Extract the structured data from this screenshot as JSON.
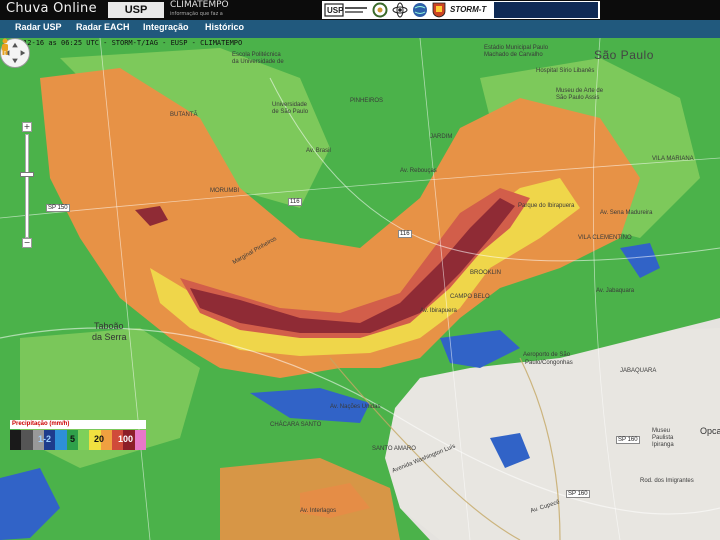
{
  "header": {
    "app_title": "Chuva Online",
    "usp_logo": "USP",
    "climatempo_logo": "CLIMATEMPO",
    "climatempo_sub": "informação que faz a diferença",
    "partner_logo": "STORM-T"
  },
  "nav": {
    "items": [
      "Radar USP",
      "Radar EACH",
      "Integração",
      "Histórico"
    ]
  },
  "map": {
    "timestamp": "2014-12-16 as 06:25 UTC - STORM-T/IAG - EUSP - CLIMATEMPO",
    "places": {
      "sao_paulo": "São Paulo",
      "taboao": "Taboão",
      "da_serra": "da Serra",
      "aeroporto": "Aeroporto de São",
      "aeroporto2": "Paulo/Congonhas",
      "escola": "Escola Politécnica",
      "escola2": "da Universidade de",
      "cidade_univ": "Universidade",
      "cidade_univ2": "de São Paulo",
      "estadio": "Estádio Municipal Paulo",
      "estadio2": "Machado de Carvalho",
      "hospital": "Hospital Sírio Libanês",
      "museu": "Museu de Arte de",
      "museu2": "São Paulo Assis",
      "parque_ibira": "Parque do Ibirapuera",
      "vila_clementino": "VILA CLEMENTINO",
      "vila_mariana": "VILA MARIANA",
      "campo_belo": "CAMPO BELO",
      "jabaquara": "JABAQUARA",
      "santo_amaro": "SANTO AMARO",
      "chacara": "CHÁCARA SANTO",
      "morumbi": "MORUMBI",
      "butanta": "BUTANTÃ",
      "jardim_paulista": "JARDIM",
      "pinheiros": "PINHEIROS",
      "brooklin": "BROOKLIN",
      "ipiranga": "Museu",
      "ipiranga2": "Paulista",
      "ipiranga3": "Ipiranga",
      "opca": "Opca",
      "av_nacoes": "Av. Nações Unidas",
      "av_brasil": "Av. Brasil",
      "av_washington": "Avenida Washington Luís",
      "av_interlagos": "Av. Interlagos",
      "av_ibira": "Av. Ibirapuera",
      "av_jabaquara": "Av. Jabaquara",
      "rod_imigrantes": "Rod. dos Imigrantes",
      "av_cupece": "Av. Cupecê",
      "av_sena": "Av. Sena Madureira",
      "marg_pinheiros": "Marginal Pinheiros",
      "av_reboucas": "Av. Rebouças"
    },
    "shields": [
      "116",
      "116",
      "SP 160",
      "SP 160",
      "SP 150"
    ]
  },
  "controls": {
    "zoom_in": "+",
    "zoom_out": "−"
  },
  "legend": {
    "title": "Precipitação (mm/h)",
    "labels": [
      "1-2",
      "5",
      "20",
      "100"
    ],
    "colors": [
      "#1a1a1a",
      "#555555",
      "#999999",
      "#1e3c8c",
      "#2e8fd8",
      "#2fa04a",
      "#7ed05a",
      "#f0e040",
      "#f0a040",
      "#d04a3a",
      "#8c1e28",
      "#e878c8"
    ]
  },
  "colors": {
    "rain_green": "#4bb24a",
    "rain_light_green": "#86cc5e",
    "rain_yellow": "#efd64a",
    "rain_orange": "#e79246",
    "rain_red": "#d25e4a",
    "rain_dark": "#8f2b35",
    "rain_blue": "#3163c7",
    "navbar": "#21597d"
  }
}
